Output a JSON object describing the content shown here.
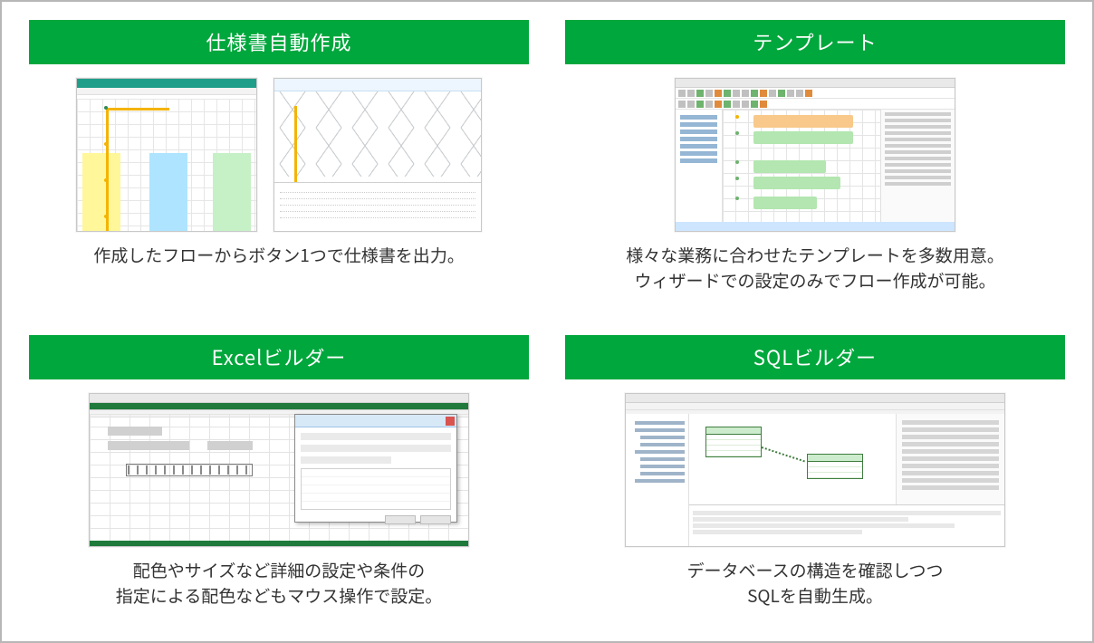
{
  "cards": [
    {
      "title": "仕様書自動作成",
      "caption": "作成したフローからボタン1つで仕様書を出力。"
    },
    {
      "title": "テンプレート",
      "caption": "様々な業務に合わせたテンプレートを多数用意。\nウィザードでの設定のみでフロー作成が可能。"
    },
    {
      "title": "Excelビルダー",
      "caption": "配色やサイズなど詳細の設定や条件の\n指定による配色などもマウス操作で設定。"
    },
    {
      "title": "SQLビルダー",
      "caption": "データベースの構造を確認しつつ\nSQLを自動生成。"
    }
  ],
  "colors": {
    "accent": "#00a73c"
  }
}
